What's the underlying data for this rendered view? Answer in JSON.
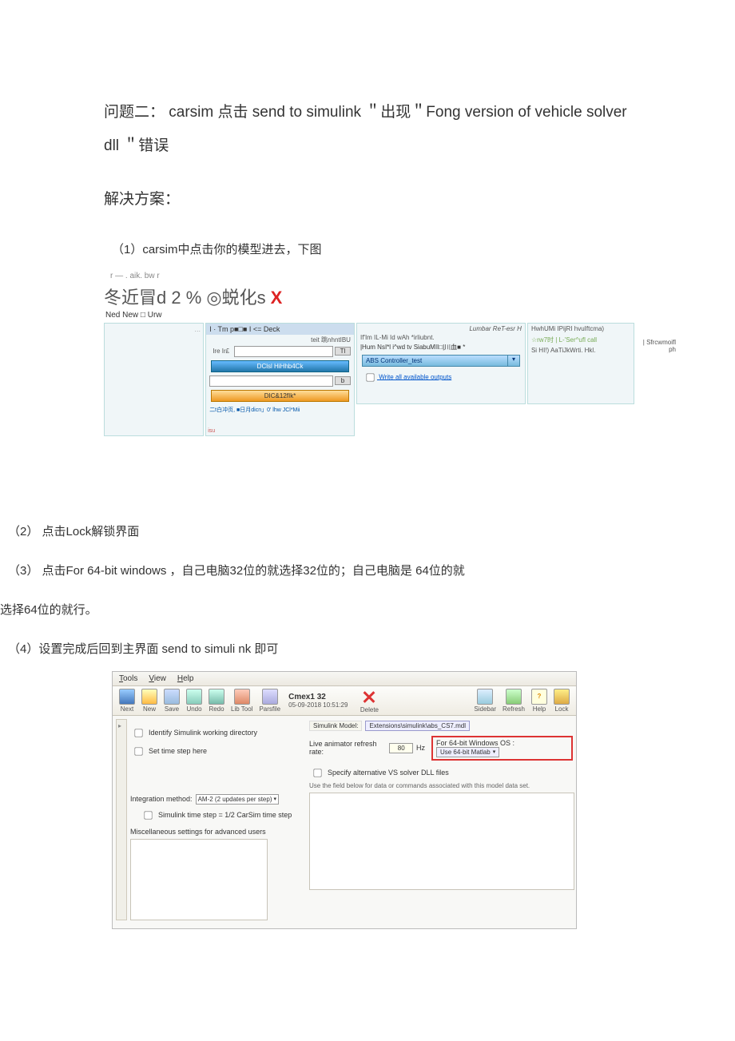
{
  "doc": {
    "title_line": "问题二：   carsim 点击  send to simulink ＂出现＂Fong version of vehicle solver dll ＂错误",
    "solution_heading": "解决方案：",
    "step1": "（1）carsim中点击你的模型进去，下图",
    "small_caption": "r —       . aik. bw r",
    "step2": "（2）  点击Lock解锁界面",
    "step3": "（3）  点击For 64-bit windows  ，自己电脑32位的就选择32位的；自己电脑是  64位的就",
    "step3_cont": "选择64位的就行。",
    "step4": "（4）设置完成后回到主界面       send to simuli nk 即可"
  },
  "shot1": {
    "deco_text": "冬近冒d 2 %  ◎蜕化s",
    "sub_left": "Ned New □ Urw",
    "mid_top": "I ·   Tm p■□■ I <=              Deck",
    "mid_sub": "teit 跳nhntIBU",
    "mid_row_unit1": "Tl",
    "mid_row_label": "Ire  Ir£",
    "mid_btn_blue": "DClsl  HiHhb4Ck",
    "mid_row_unit2": "b",
    "mid_btn_orange": "DIC&12fIk*",
    "mid_small": "二t白冲页, ■日月dicn」0' lhw JCl*Mii",
    "mid_corner": "isu",
    "right_italic": "Lumbar ReT-esr H",
    "right_line1": "If'Im IL-Mi Id      wAh *irliubnt.",
    "right_line2": "|Hum NsI*l i^wd tv SiabuMII□|川血■  *",
    "right_dd": "ABS Controller_test",
    "right_link": "Write all available outputs",
    "far_l1": "HwhUMi IPijRI hvuIftcma)",
    "far_l2": "☆rw7时           | L-'Ser^ufl call",
    "far_l3": "Si HI!)  AaTiJkWrti. Hkl.",
    "far_l4": "| Sfrcwmoifl ph"
  },
  "shot2": {
    "menu": {
      "tools": "Tools",
      "view": "View",
      "help": "Help"
    },
    "tools": {
      "next": "Next",
      "new": "New",
      "save": "Save",
      "undo": "Undo",
      "redo": "Redo",
      "lib": "Lib Tool",
      "par": "Parsfile",
      "sidebar": "Sidebar",
      "refresh": "Refresh",
      "help": "Help",
      "lock": "Lock",
      "delete": "Delete"
    },
    "cmex_title": "Cmex1 32",
    "cmex_time": "05-09-2018 10:51:29",
    "left": {
      "chk1": "Identify Simulink working directory",
      "chk2": "Set time step here",
      "integ_label": "Integration method:",
      "integ_value": "AM-2 (2 updates per step)",
      "chk3": "Simulink time step = 1/2 CarSim time step",
      "misc_label": "Miscellaneous settings for advanced users"
    },
    "right": {
      "model_label": "Simulink Model:",
      "model_value": "Extensions\\simulink\\abs_CS7.mdl",
      "anim_label": "Live animator refresh rate:",
      "anim_value": "80",
      "anim_unit": "Hz",
      "os_label": "For 64-bit Windows OS :",
      "os_value": "Use 64-bit Matlab",
      "chk4": "Specify alternative VS solver DLL files",
      "note": "Use the field below for data or commands associated with this model data set."
    }
  }
}
